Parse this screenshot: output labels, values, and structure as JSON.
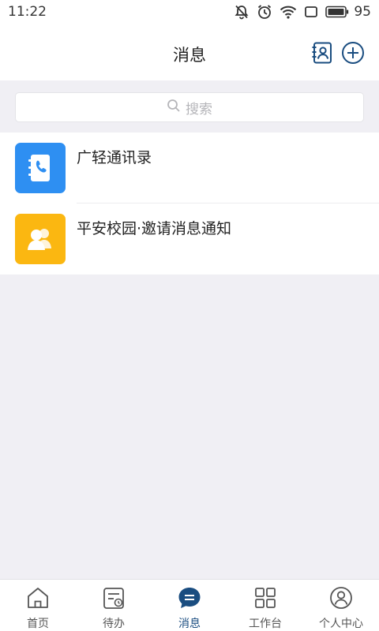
{
  "status_bar": {
    "time": "11:22",
    "battery": "95",
    "icons": [
      "mute-icon",
      "alarm-icon",
      "wifi-icon",
      "screen-icon",
      "battery-icon"
    ]
  },
  "header": {
    "title": "消息",
    "icons": [
      "contacts-book-icon",
      "add-circle-icon"
    ]
  },
  "search": {
    "placeholder": "搜索",
    "icon": "search-icon"
  },
  "messages": [
    {
      "title": "广轻通讯录",
      "icon": "phone-book-icon",
      "icon_color": "#2e8ff2"
    },
    {
      "title": "平安校园·邀请消息通知",
      "icon": "group-users-icon",
      "icon_color": "#fbb711"
    }
  ],
  "tabs": [
    {
      "label": "首页",
      "icon": "home-icon",
      "active": false
    },
    {
      "label": "待办",
      "icon": "todo-calendar-icon",
      "active": false
    },
    {
      "label": "消息",
      "icon": "message-icon",
      "active": true
    },
    {
      "label": "工作台",
      "icon": "grid-apps-icon",
      "active": false
    },
    {
      "label": "个人中心",
      "icon": "user-profile-icon",
      "active": false
    }
  ],
  "colors": {
    "accent": "#1a4d80",
    "background": "#f0eff4",
    "blue_icon": "#2e8ff2",
    "yellow_icon": "#fbb711"
  }
}
